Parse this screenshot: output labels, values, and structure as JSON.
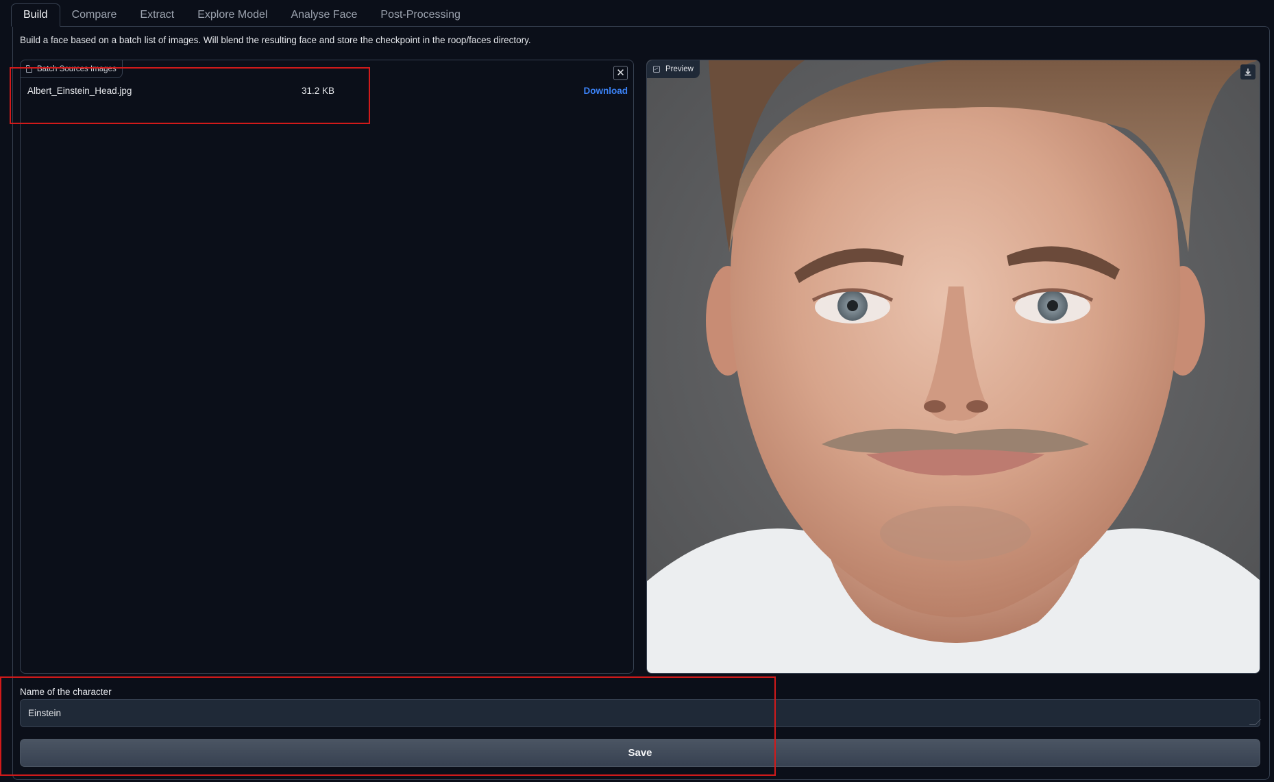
{
  "tabs": [
    {
      "label": "Build",
      "active": true
    },
    {
      "label": "Compare"
    },
    {
      "label": "Extract"
    },
    {
      "label": "Explore Model"
    },
    {
      "label": "Analyse Face"
    },
    {
      "label": "Post-Processing"
    }
  ],
  "description": "Build a face based on a batch list of images. Will blend the resulting face and store the checkpoint in the roop/faces directory.",
  "batch_sources": {
    "label": "Batch Sources Images",
    "label_icon": "file-icon",
    "clear_icon": "close-icon",
    "files": [
      {
        "name": "Albert_Einstein_Head.jpg",
        "size": "31.2 KB",
        "action": "Download"
      }
    ]
  },
  "preview": {
    "label": "Preview",
    "label_icon": "image-icon",
    "download_icon": "download-icon"
  },
  "character": {
    "label": "Name of the character",
    "value": "Einstein"
  },
  "save_label": "Save",
  "colors": {
    "background": "#0b0f19",
    "border": "#374151",
    "link": "#3b82f6",
    "highlight": "#d11a1a",
    "input_bg": "#1f2937"
  }
}
